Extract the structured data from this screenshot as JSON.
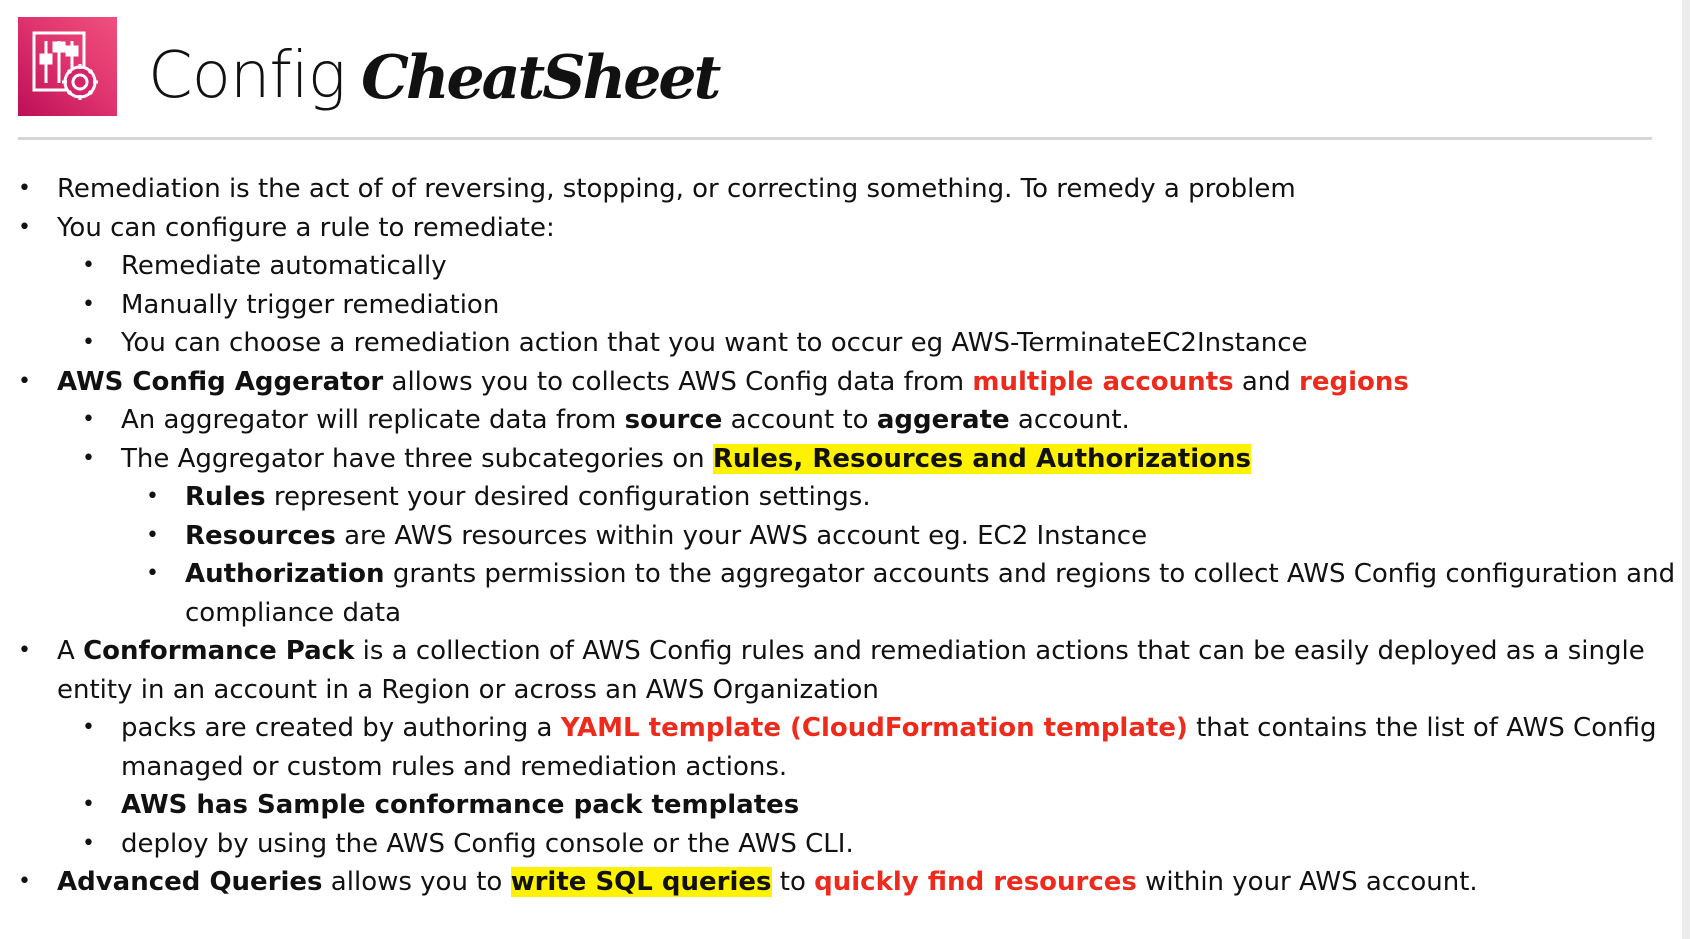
{
  "header": {
    "title_light": "Config",
    "title_bold": "CheatSheet",
    "icon": "aws-config-icon",
    "icon_color": "#d6246a"
  },
  "colors": {
    "emphasis_red": "#ee2a1c",
    "highlight_yellow": "#fff200"
  },
  "lines": [
    {
      "t1": "Remediation is the act of of reversing, stopping, or correcting something. To remedy a problem"
    },
    {
      "t1": "You can configure a rule to remediate:"
    },
    {
      "t1": "Remediate automatically"
    },
    {
      "t1": "Manually trigger remediation"
    },
    {
      "t1": "You can choose a remediation action that you want to occur eg AWS-TerminateEC2Instance"
    },
    {
      "t1": "AWS Config Aggerator",
      "t2": " allows you to collects AWS Config data from ",
      "t3": "multiple accounts",
      "t4": " and ",
      "t5": "regions"
    },
    {
      "t1": "An aggregator will replicate data from ",
      "t2": "source",
      "t3": " account to ",
      "t4": "aggerate",
      "t5": " account."
    },
    {
      "t1": "The Aggregator have three subcategories on ",
      "t2": "Rules, Resources and Authorizations"
    },
    {
      "t1": "Rules",
      "t2": " represent your desired configuration settings."
    },
    {
      "t1": "Resources",
      "t2": " are AWS resources within your AWS account eg. EC2 Instance"
    },
    {
      "t1": "Authorization",
      "t2": " grants permission to the aggregator accounts and regions to collect AWS Config  configuration and"
    },
    {
      "t1": "compliance data"
    },
    {
      "t1": "A ",
      "t2": "Conformance Pack",
      "t3": " is a collection of AWS Config rules and remediation actions that can be easily deployed as a single"
    },
    {
      "t1": "entity in an account in a Region or across an AWS Organization"
    },
    {
      "t1": "packs are created by authoring a ",
      "t2": "YAML template  (CloudFormation template)",
      "t3": " that contains the list of AWS Config"
    },
    {
      "t1": "managed or custom rules and remediation actions."
    },
    {
      "t1": "AWS has Sample conformance pack templates"
    },
    {
      "t1": "deploy by using the AWS Config console or the AWS CLI."
    },
    {
      "t1": "Advanced Queries",
      "t2": " allows you to ",
      "t3": "write SQL queries",
      "t4": " to ",
      "t5": "quickly find resources",
      "t6": " within your AWS account."
    }
  ]
}
